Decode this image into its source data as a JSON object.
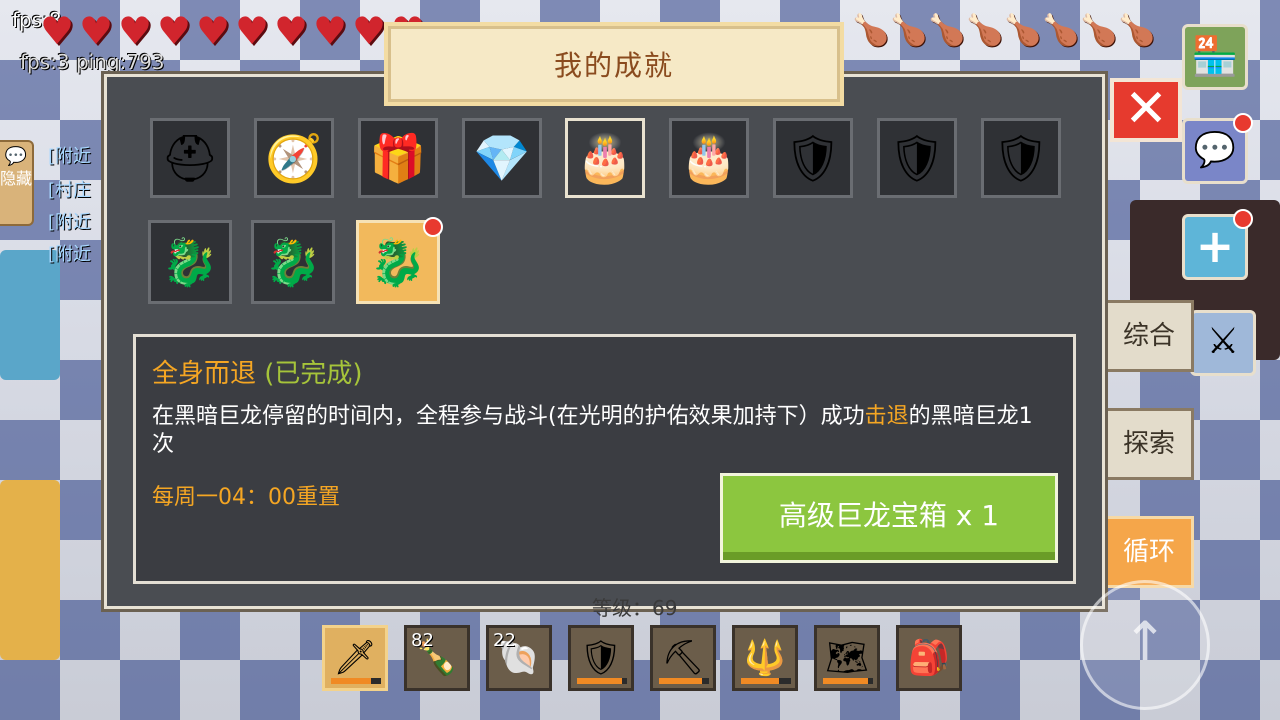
{
  "hud": {
    "fps_main": "fps:8",
    "fps_ping": "fps:3 ping:793",
    "hearts": 10,
    "foods": 8
  },
  "chat": {
    "hide_label": "隐藏",
    "lines": [
      "[附近",
      "[村庄",
      "[附近",
      "[附近"
    ]
  },
  "panel": {
    "title": "我的成就",
    "close_icon": "close-x-icon",
    "achievements_row1": [
      {
        "icon": "dark-helmet-icon",
        "glyph": "⛑"
      },
      {
        "icon": "compass-icon",
        "glyph": "🧭"
      },
      {
        "icon": "treasure-chest-icon",
        "glyph": "🎁"
      },
      {
        "icon": "purple-crystal-icon",
        "glyph": "💎"
      },
      {
        "icon": "cake-icon",
        "glyph": "🎂"
      },
      {
        "icon": "birthday-cake-icon",
        "glyph": "🎂"
      },
      {
        "icon": "sword-shield-badge-icon",
        "glyph": "🛡"
      },
      {
        "icon": "sword-shield-badge-icon",
        "glyph": "🛡"
      },
      {
        "icon": "sword-shield-badge-icon",
        "glyph": "🛡"
      }
    ],
    "achievements_row2": [
      {
        "icon": "purple-dragon-head-icon",
        "glyph": "🐉"
      },
      {
        "icon": "purple-dragon-head-icon",
        "glyph": "🐉"
      },
      {
        "icon": "purple-dragon-head-icon",
        "glyph": "🐉"
      }
    ],
    "detail": {
      "title": "全身而退",
      "status": "(已完成)",
      "desc_before": "在黑暗巨龙停留的时间内，全程参与战斗(在光明的护佑效果加持下）成功",
      "desc_highlight": "击退",
      "desc_after": "的黑暗巨龙1次",
      "reset": "每周一04：00重置",
      "reward": "高级巨龙宝箱 x 1"
    }
  },
  "side_tabs": [
    "综合",
    "探索",
    "循环"
  ],
  "hotbar": {
    "level": "等级：69",
    "slots": [
      {
        "icon": "dark-sword-icon",
        "glyph": "🗡",
        "count": "",
        "durability": 0.8
      },
      {
        "icon": "wine-bottle-icon",
        "glyph": "🍾",
        "count": "82",
        "durability": null
      },
      {
        "icon": "purple-shell-icon",
        "glyph": "🐚",
        "count": "22",
        "durability": null
      },
      {
        "icon": "red-shield-armor-icon",
        "glyph": "🛡",
        "count": "",
        "durability": 0.9
      },
      {
        "icon": "crystal-pickaxe-icon",
        "glyph": "⛏",
        "count": "",
        "durability": 0.85
      },
      {
        "icon": "spiked-mace-icon",
        "glyph": "🔱",
        "count": "",
        "durability": 0.75
      },
      {
        "icon": "treasure-map-icon",
        "glyph": "🗺",
        "count": "",
        "durability": 0.9
      },
      {
        "icon": "backpack-icon",
        "glyph": "🎒",
        "count": "",
        "durability": null
      }
    ]
  }
}
